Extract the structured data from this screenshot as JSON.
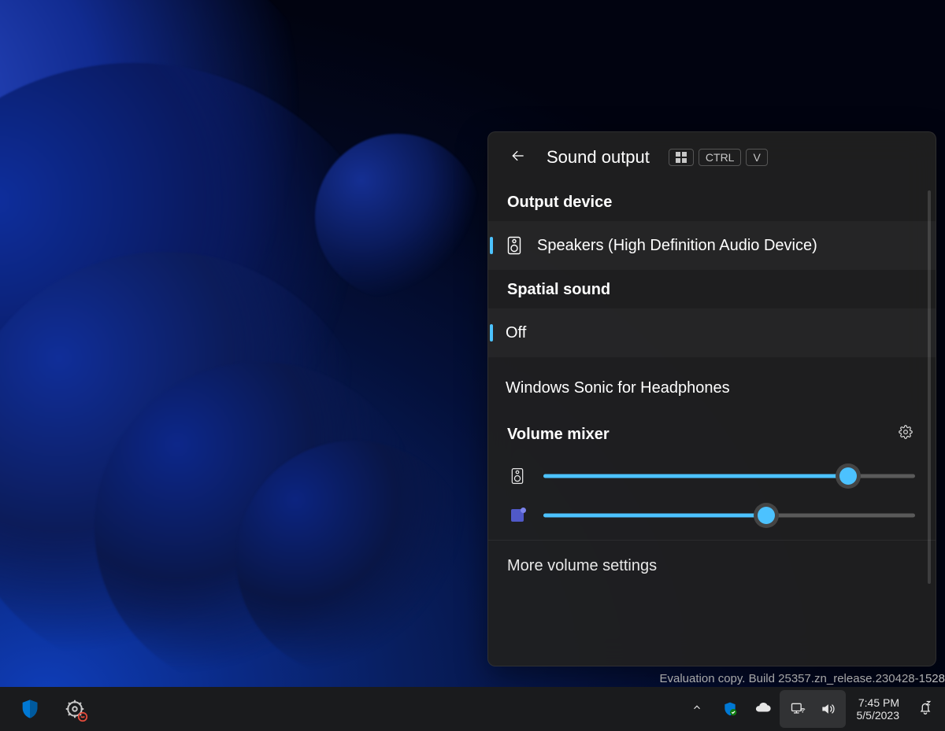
{
  "popup": {
    "title": "Sound output",
    "shortcut_keys": [
      "WIN",
      "CTRL",
      "V"
    ],
    "sections": {
      "output_device": {
        "label": "Output device",
        "items": [
          {
            "label": "Speakers (High Definition Audio Device)",
            "selected": true
          }
        ]
      },
      "spatial_sound": {
        "label": "Spatial sound",
        "items": [
          {
            "label": "Off",
            "selected": true
          },
          {
            "label": "Windows Sonic for Headphones",
            "selected": false
          }
        ]
      },
      "volume_mixer": {
        "label": "Volume mixer",
        "channels": [
          {
            "name": "System Speakers",
            "icon": "speaker-icon",
            "percent": 82
          },
          {
            "name": "Microsoft Teams",
            "icon": "teams-icon",
            "percent": 60
          }
        ]
      }
    },
    "more_link": "More volume settings"
  },
  "desktop_watermark": "Evaluation copy. Build 25357.zn_release.230428-1528",
  "taskbar": {
    "clock": {
      "time": "7:45 PM",
      "date": "5/5/2023"
    }
  },
  "colors": {
    "accent": "#4cc2ff",
    "panel": "#202020",
    "taskbar": "#1a1b1d"
  }
}
